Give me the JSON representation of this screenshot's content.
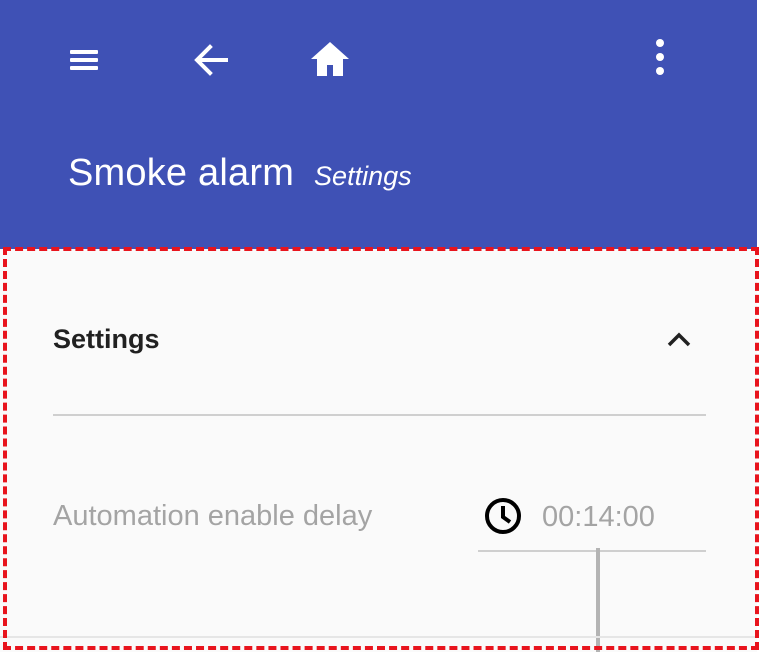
{
  "appbar": {
    "title": "Smoke alarm",
    "subtitle": "Settings",
    "background": "#3f51b5",
    "icons": {
      "menu": "menu-icon",
      "back": "arrow-left-icon",
      "home": "home-icon",
      "more": "more-vertical-icon"
    }
  },
  "settings": {
    "section_title": "Settings",
    "expanded_icon": "chevron-up-icon",
    "field_label": "Automation enable delay",
    "field_icon": "clock-icon",
    "field_value": "00:14:00"
  },
  "colors": {
    "content_background": "#fafafa",
    "muted_text": "#a4a4a4",
    "highlight_border": "#e8141d"
  }
}
